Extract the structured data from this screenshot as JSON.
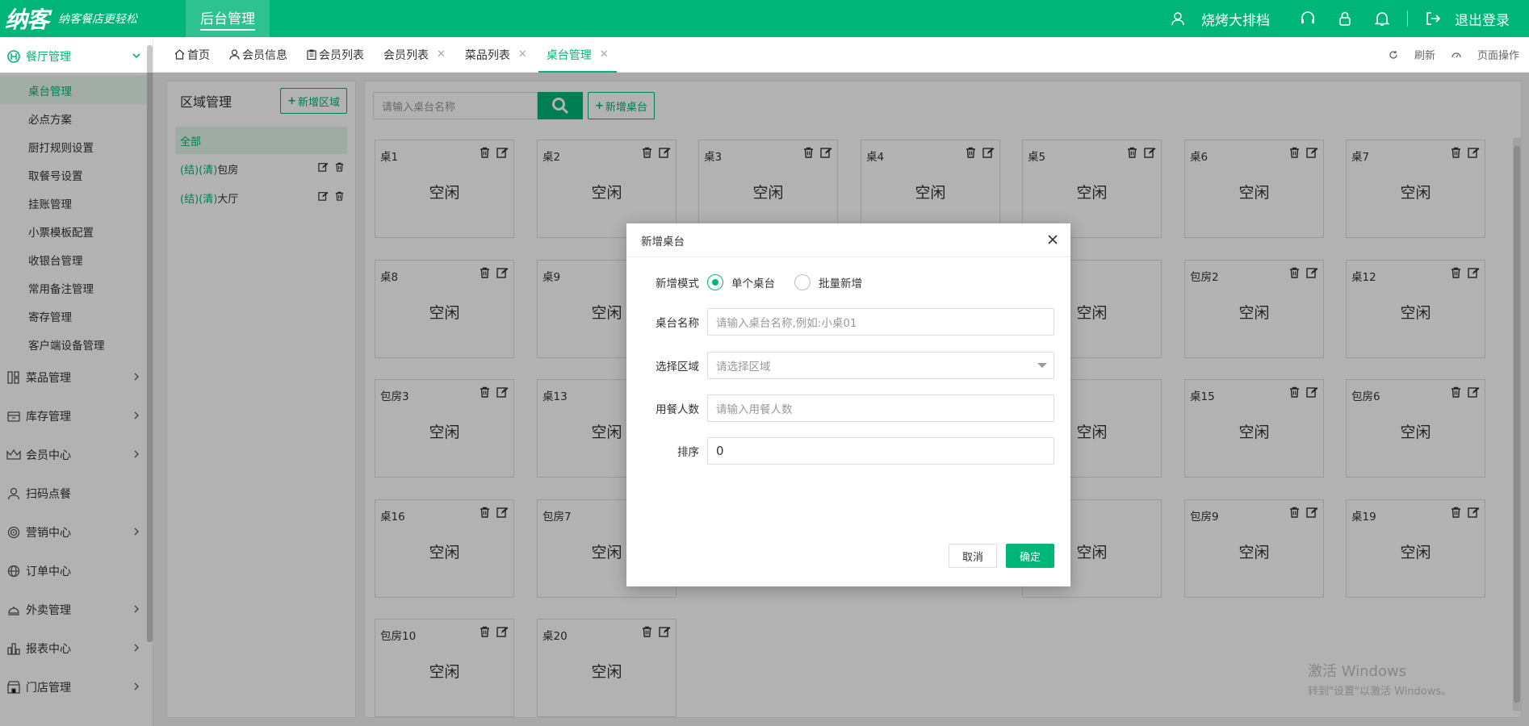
{
  "header": {
    "logo_text": "纳客",
    "slogan": "纳客餐店更轻松",
    "top_tab": "后台管理",
    "user_name": "烧烤大排档",
    "logout": "退出登录",
    "colors": {
      "brand": "#00b578"
    }
  },
  "sidebar": {
    "active_group": {
      "label": "餐厅管理",
      "icon": "restaurant-icon"
    },
    "items": [
      {
        "label": "桌台管理",
        "active": true
      },
      {
        "label": "必点方案"
      },
      {
        "label": "厨打规则设置"
      },
      {
        "label": "取餐号设置"
      },
      {
        "label": "挂账管理"
      },
      {
        "label": "小票模板配置"
      },
      {
        "label": "收银台管理"
      },
      {
        "label": "常用备注管理"
      },
      {
        "label": "寄存管理"
      },
      {
        "label": "客户端设备管理"
      }
    ],
    "groups": [
      {
        "label": "菜品管理",
        "icon": "dish-icon",
        "has_chevron": true
      },
      {
        "label": "库存管理",
        "icon": "inventory-icon",
        "has_chevron": true
      },
      {
        "label": "会员中心",
        "icon": "crown-icon",
        "has_chevron": true
      },
      {
        "label": "扫码点餐",
        "icon": "user-icon",
        "has_chevron": false
      },
      {
        "label": "营销中心",
        "icon": "target-icon",
        "has_chevron": true
      },
      {
        "label": "订单中心",
        "icon": "globe-icon",
        "has_chevron": false
      },
      {
        "label": "外卖管理",
        "icon": "delivery-icon",
        "has_chevron": true
      },
      {
        "label": "报表中心",
        "icon": "report-icon",
        "has_chevron": true
      },
      {
        "label": "门店管理",
        "icon": "store-icon",
        "has_chevron": true
      }
    ]
  },
  "tabs": {
    "items": [
      {
        "label": "首页",
        "icon": "home-icon",
        "closable": false
      },
      {
        "label": "会员信息",
        "icon": "user-icon",
        "closable": false
      },
      {
        "label": "会员列表",
        "icon": "clipboard-icon",
        "closable": false
      },
      {
        "label": "会员列表",
        "closable": true
      },
      {
        "label": "菜品列表",
        "closable": true
      },
      {
        "label": "桌台管理",
        "closable": true,
        "active": true
      }
    ],
    "refresh": "刷新",
    "page_ops": "页面操作"
  },
  "area": {
    "title": "区域管理",
    "add_button": "新增区域",
    "all": "全部",
    "rows": [
      {
        "tag": "(结)(清)",
        "name": "包房"
      },
      {
        "tag": "(结)(清)",
        "name": "大厅"
      }
    ]
  },
  "tables_panel": {
    "search_placeholder": "请输入桌台名称",
    "add_button": "新增桌台",
    "status_idle": "空闲",
    "cards": [
      {
        "name": "桌1",
        "status": "空闲"
      },
      {
        "name": "桌2",
        "status": "空闲"
      },
      {
        "name": "桌3",
        "status": "空闲"
      },
      {
        "name": "桌4",
        "status": "空闲"
      },
      {
        "name": "桌5",
        "status": "空闲"
      },
      {
        "name": "桌6",
        "status": "空闲"
      },
      {
        "name": "桌7",
        "status": "空闲"
      },
      {
        "name": "桌8",
        "status": "空闲"
      },
      {
        "name": "桌9",
        "status": "空闲"
      },
      {
        "name": "",
        "status": ""
      },
      {
        "name": "",
        "status": ""
      },
      {
        "name": "",
        "status": "空闲"
      },
      {
        "name": "包房2",
        "status": "空闲"
      },
      {
        "name": "桌12",
        "status": "空闲"
      },
      {
        "name": "包房3",
        "status": "空闲"
      },
      {
        "name": "桌13",
        "status": "空闲"
      },
      {
        "name": "",
        "status": ""
      },
      {
        "name": "",
        "status": ""
      },
      {
        "name": "",
        "status": "空闲"
      },
      {
        "name": "桌15",
        "status": "空闲"
      },
      {
        "name": "包房6",
        "status": "空闲"
      },
      {
        "name": "桌16",
        "status": "空闲"
      },
      {
        "name": "包房7",
        "status": "空闲"
      },
      {
        "name": "",
        "status": ""
      },
      {
        "name": "",
        "status": ""
      },
      {
        "name": "",
        "status": "空闲"
      },
      {
        "name": "包房9",
        "status": "空闲"
      },
      {
        "name": "桌19",
        "status": "空闲"
      },
      {
        "name": "包房10",
        "status": "空闲"
      },
      {
        "name": "桌20",
        "status": "空闲"
      }
    ]
  },
  "watermark": {
    "line1": "激活 Windows",
    "line2": "转到\"设置\"以激活 Windows。"
  },
  "modal": {
    "title": "新增桌台",
    "mode_label": "新增模式",
    "mode_options": [
      {
        "label": "单个桌台",
        "selected": true
      },
      {
        "label": "批量新增",
        "selected": false
      }
    ],
    "name_label": "桌台名称",
    "name_placeholder": "请输入桌台名称,例如:小桌01",
    "area_label": "选择区域",
    "area_placeholder": "请选择区域",
    "people_label": "用餐人数",
    "people_placeholder": "请输入用餐人数",
    "sort_label": "排序",
    "sort_value": "0",
    "cancel": "取消",
    "confirm": "确定"
  }
}
